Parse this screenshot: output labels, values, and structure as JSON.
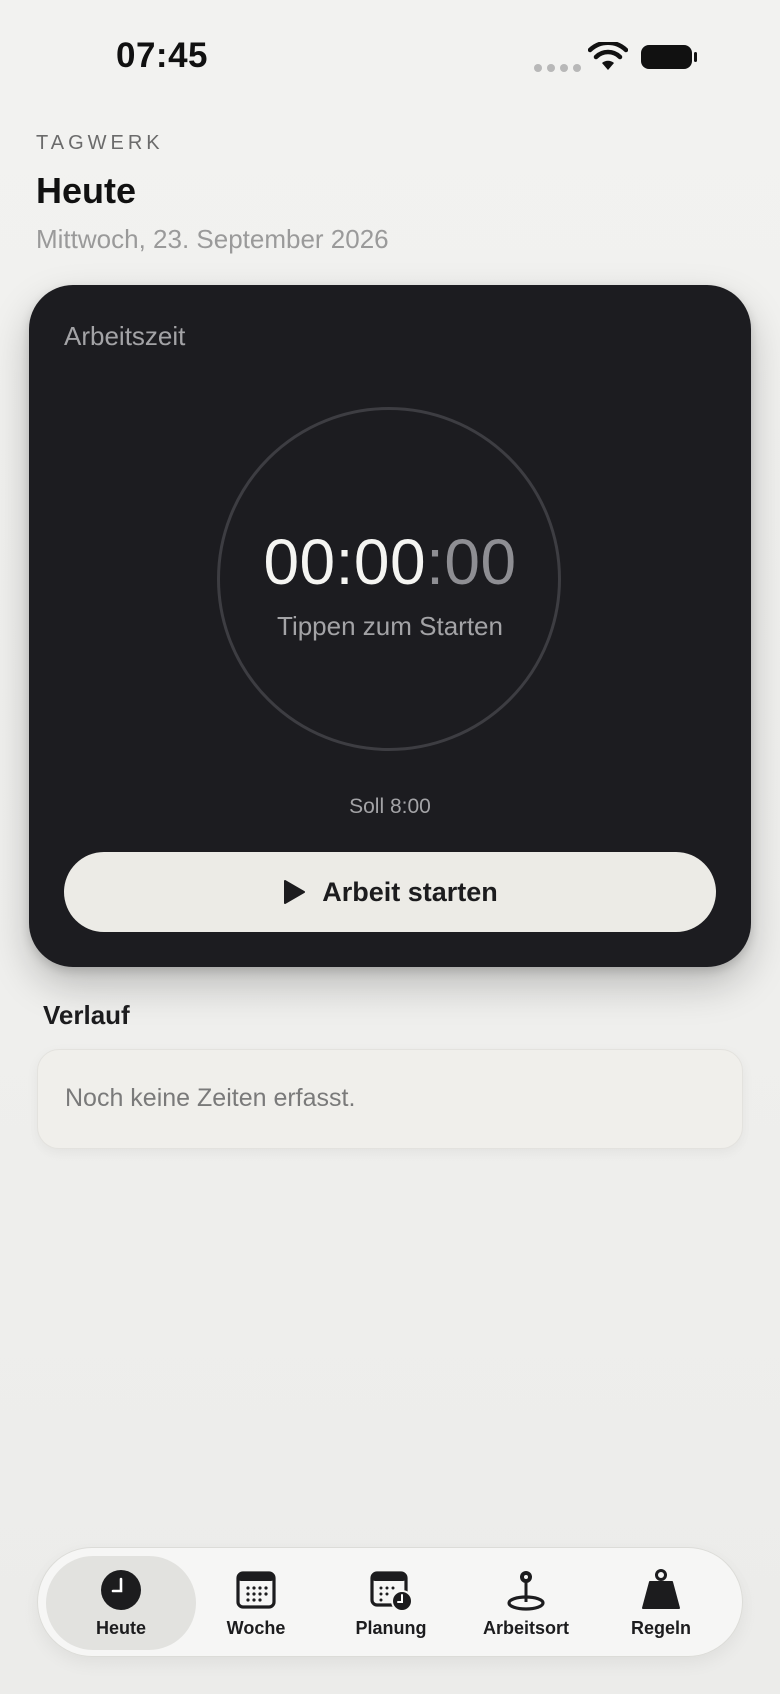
{
  "status_bar": {
    "time": "07:45"
  },
  "header": {
    "app_name": "TAGWERK",
    "title": "Heute",
    "date": "Mittwoch, 23. September 2026"
  },
  "timer_card": {
    "label": "Arbeitszeit",
    "time_main": "00:00",
    "time_seconds": ":00",
    "hint": "Tippen zum Starten",
    "target": "Soll 8:00",
    "start_button_label": "Arbeit starten"
  },
  "history": {
    "title": "Verlauf",
    "empty_message": "Noch keine Zeiten erfasst."
  },
  "tabs": [
    {
      "label": "Heute",
      "icon": "clock-icon",
      "active": true
    },
    {
      "label": "Woche",
      "icon": "calendar-icon",
      "active": false
    },
    {
      "label": "Planung",
      "icon": "calendar-clock-icon",
      "active": false
    },
    {
      "label": "Arbeitsort",
      "icon": "location-pin-icon",
      "active": false
    },
    {
      "label": "Regeln",
      "icon": "weight-icon",
      "active": false
    }
  ],
  "colors": {
    "card_background": "#1c1c20",
    "accent_button": "#ecebe6",
    "page_background": "#f2f2f0"
  }
}
